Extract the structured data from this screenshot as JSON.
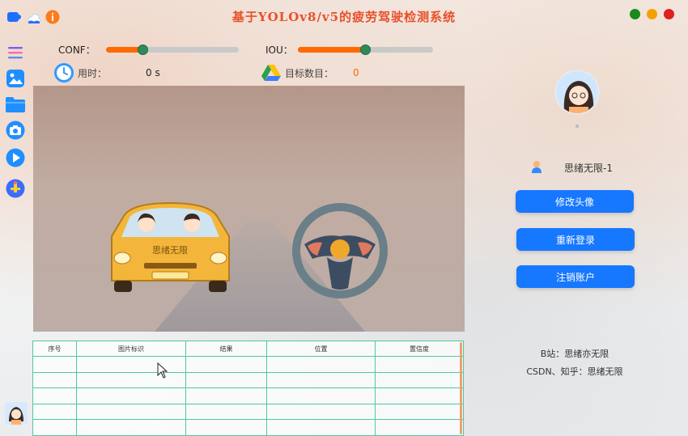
{
  "app": {
    "title": "基于YOLOv8/v5的疲劳驾驶检测系统"
  },
  "window_controls": {
    "colors": [
      "#1a8a1a",
      "#f5a000",
      "#e02020"
    ],
    "icons": [
      "minimize-icon",
      "maximize-icon",
      "close-icon"
    ]
  },
  "sidebar": {
    "items": [
      {
        "name": "menu-icon",
        "color": "#7a5cff"
      },
      {
        "name": "image-icon",
        "color": "#1f8fff"
      },
      {
        "name": "folder-icon",
        "color": "#1f8fff"
      },
      {
        "name": "camera-icon",
        "color": "#1f8fff"
      },
      {
        "name": "play-icon",
        "color": "#1f8fff"
      },
      {
        "name": "model-icon",
        "color": "#1f8fff"
      }
    ]
  },
  "controls": {
    "conf_label": "CONF：",
    "conf_value": 0.28,
    "iou_label": "IOU：",
    "iou_value": 0.5
  },
  "info": {
    "time_label": "用时：",
    "time_value": "0 s",
    "target_label": "目标数目：",
    "target_value": "0"
  },
  "display": {
    "car_text": "思绪无限"
  },
  "table": {
    "headers": [
      "序号",
      "图片标识",
      "结果",
      "位置",
      "置信度"
    ],
    "rows": [
      [
        "",
        "",
        "",
        "",
        ""
      ],
      [
        "",
        "",
        "",
        "",
        ""
      ],
      [
        "",
        "",
        "",
        "",
        ""
      ],
      [
        "",
        "",
        "",
        "",
        ""
      ],
      [
        "",
        "",
        "",
        "",
        ""
      ]
    ]
  },
  "user": {
    "name": "思绪无限-1",
    "buttons": {
      "change_avatar": "修改头像",
      "relogin": "重新登录",
      "logout": "注销账户"
    }
  },
  "credits": {
    "line1": "B站：思绪亦无限",
    "line2": "CSDN、知乎：思绪无限"
  }
}
